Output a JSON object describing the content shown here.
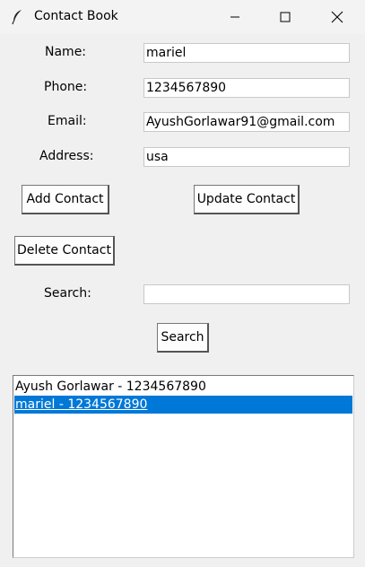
{
  "window": {
    "title": "Contact Book",
    "icon": "feather-icon",
    "controls": [
      "minimize-icon",
      "maximize-icon",
      "close-icon"
    ]
  },
  "form": {
    "name_label": "Name:",
    "name_value": "mariel",
    "phone_label": "Phone:",
    "phone_value": "1234567890",
    "email_label": "Email:",
    "email_value": "AyushGorlawar91@gmail.com",
    "address_label": "Address:",
    "address_value": "usa"
  },
  "buttons": {
    "add": "Add Contact",
    "update": "Update Contact",
    "delete": "Delete Contact",
    "search": "Search"
  },
  "search": {
    "label": "Search:",
    "value": ""
  },
  "contacts": [
    {
      "text": "Ayush Gorlawar - 1234567890",
      "selected": false
    },
    {
      "text": "mariel  - 1234567890",
      "selected": true
    }
  ],
  "colors": {
    "background": "#f0f0f0",
    "selection": "#0078d7"
  }
}
